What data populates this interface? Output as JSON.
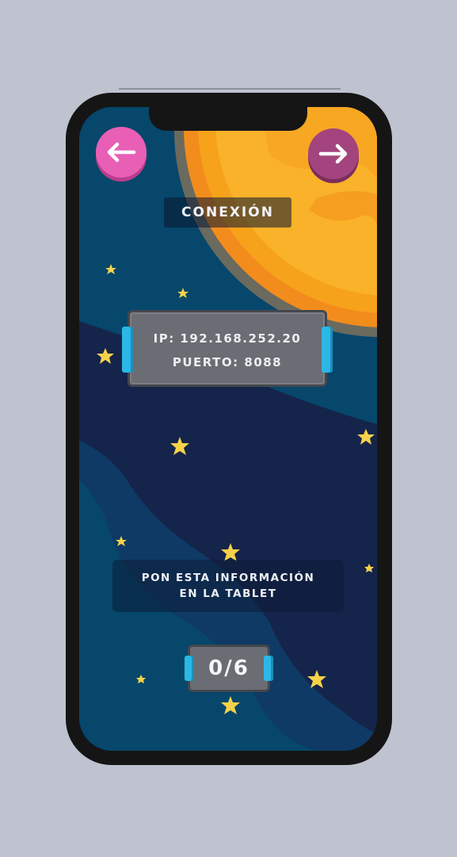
{
  "nav": {
    "back_icon": "arrow-left-icon",
    "next_icon": "arrow-right-icon",
    "back_color": "#e85fb5",
    "next_color": "#a3447e"
  },
  "header": {
    "title": "CONEXIÓN"
  },
  "connection": {
    "ip_text": "IP: 192.168.252.20",
    "port_text": "PUERTO: 8088"
  },
  "instruction": {
    "line1": "PON ESTA INFORMACIÓN",
    "line2": "EN LA TABLET"
  },
  "progress": {
    "text": "0/6",
    "current": 0,
    "total": 6
  },
  "colors": {
    "sky": "#06476b",
    "sun": "#f7a21b",
    "panel": "#6a6d73",
    "accent_tab": "#2bb8e6",
    "star": "#f6d24a"
  }
}
